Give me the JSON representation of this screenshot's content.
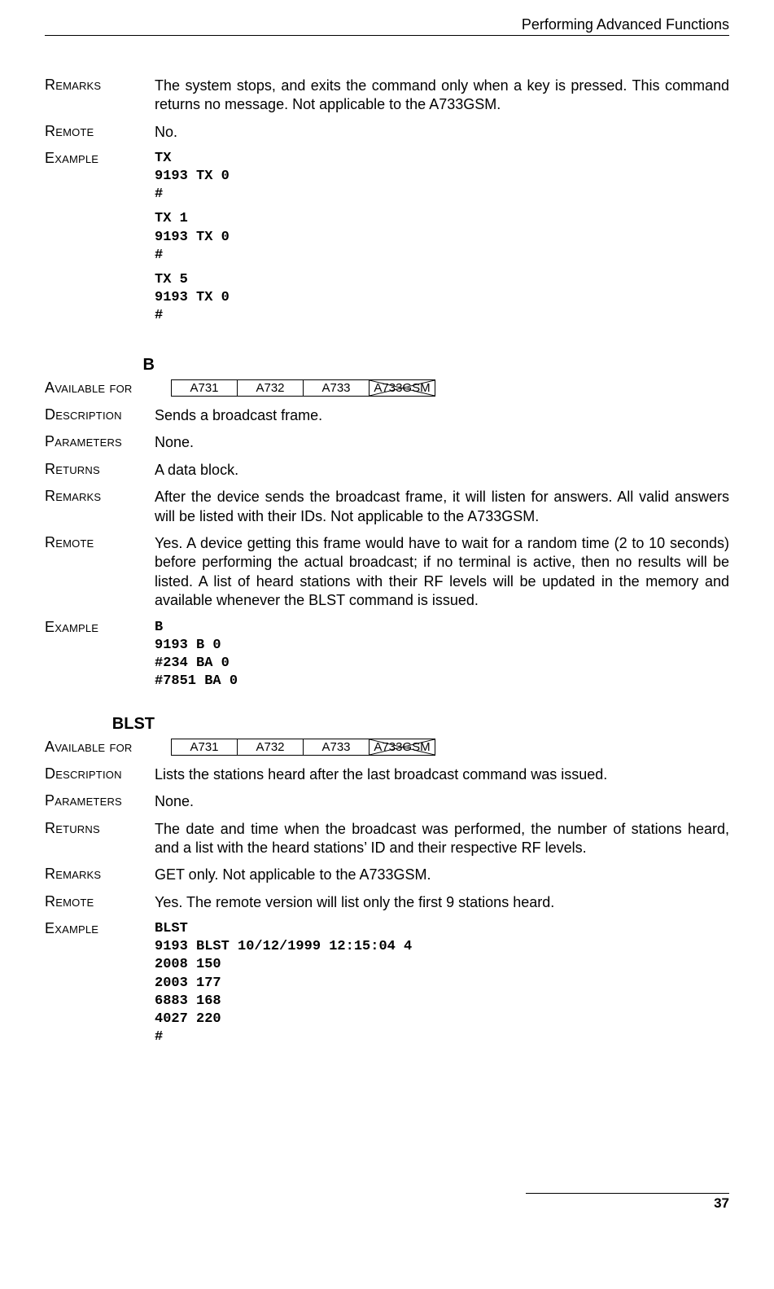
{
  "header": {
    "title": "Performing Advanced Functions"
  },
  "sec_tx": {
    "remarks_label": "Remarks",
    "remarks_body": "The system stops, and exits the command only when a key is pressed. This command returns no message. Not applicable to the A733GSM.",
    "remote_label": "Remote",
    "remote_body": "No.",
    "example_label": "Example",
    "example_block1": "TX\n9193 TX 0\n#",
    "example_block2": "TX 1\n9193 TX 0\n#",
    "example_block3": "TX 5\n9193 TX 0\n#"
  },
  "sec_b": {
    "heading": "B",
    "avail_label": "Available for",
    "avail": [
      "A731",
      "A732",
      "A733",
      "A733GSM"
    ],
    "description_label": "Description",
    "description_body": "Sends a broadcast frame.",
    "parameters_label": "Parameters",
    "parameters_body": "None.",
    "returns_label": "Returns",
    "returns_body": "A data block.",
    "remarks_label": "Remarks",
    "remarks_body": "After the device sends the broadcast frame, it will listen for answers. All valid answers will be listed with their IDs. Not applicable to the A733GSM.",
    "remote_label": "Remote",
    "remote_body": "Yes. A device getting this frame would have to wait for a random time (2 to 10 seconds) before performing the actual broadcast; if no terminal is active, then no results will be listed. A list of heard stations with their RF levels will be updated in the memory and available whenever the BLST command is issued.",
    "example_label": "Example",
    "example_block": "B\n9193 B 0\n#234 BA 0\n#7851 BA 0"
  },
  "sec_blst": {
    "heading": "BLST",
    "avail_label": "Available for",
    "avail": [
      "A731",
      "A732",
      "A733",
      "A733GSM"
    ],
    "description_label": "Description",
    "description_body": "Lists the stations heard after the last broadcast command was issued.",
    "parameters_label": "Parameters",
    "parameters_body": "None.",
    "returns_label": "Returns",
    "returns_body": "The date and time when the broadcast was performed, the number of stations heard, and a list with the heard stations’ ID and their respective RF levels.",
    "remarks_label": "Remarks",
    "remarks_body": "GET only. Not applicable to the A733GSM.",
    "remote_label": "Remote",
    "remote_body": "Yes. The remote version will list only the first 9 stations heard.",
    "example_label": "Example",
    "example_block": "BLST\n9193 BLST 10/12/1999 12:15:04 4\n2008 150\n2003 177\n6883 168\n4027 220\n#"
  },
  "footer": {
    "page_number": "37"
  }
}
